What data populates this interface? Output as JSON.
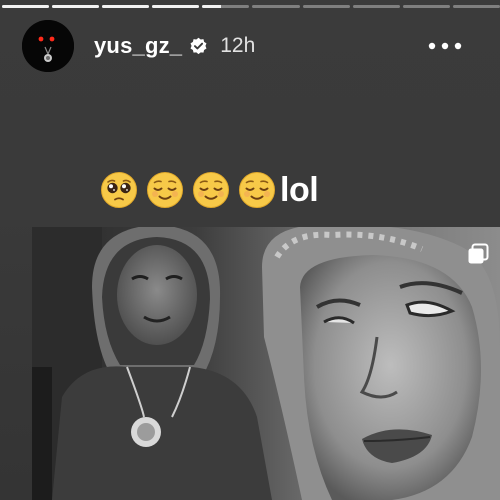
{
  "story": {
    "segment_count": 10,
    "active_segment": 4,
    "active_progress": 0.4
  },
  "header": {
    "username": "yus_gz_",
    "verified": true,
    "time": "12h",
    "more_icon": "more-horizontal-icon",
    "close_icon": "close-icon"
  },
  "caption": {
    "emojis": [
      "pleading-face",
      "relieved-face",
      "relieved-face",
      "relieved-face"
    ],
    "text": "lol"
  },
  "photo": {
    "description_icon": "multiple-photos-icon"
  },
  "colors": {
    "background": "#3a3a3a",
    "text": "#ffffff",
    "verified_badge": "#ffffff",
    "emoji_yellow": "#f7c948"
  }
}
